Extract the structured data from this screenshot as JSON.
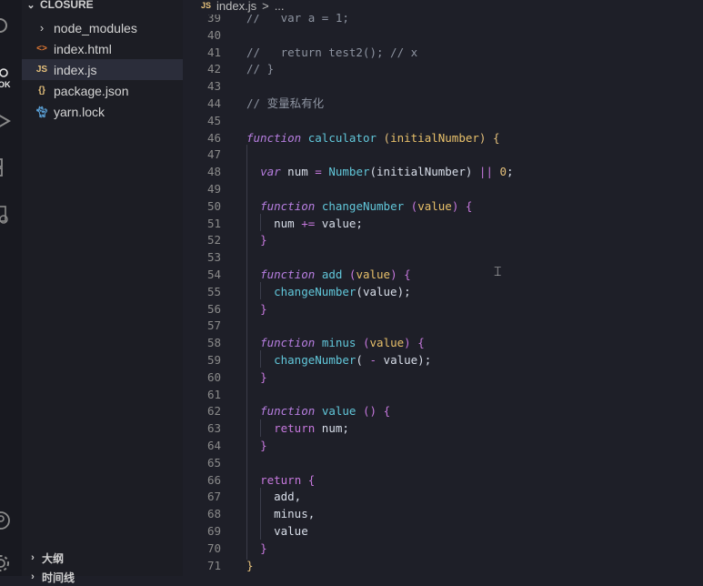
{
  "explorer": {
    "folder_name": "CLOSURE",
    "items": [
      {
        "label": "node_modules",
        "icon": "chevron-right-icon"
      },
      {
        "label": "index.html",
        "icon": "html-icon"
      },
      {
        "label": "index.js",
        "icon": "js-icon",
        "selected": true
      },
      {
        "label": "package.json",
        "icon": "json-icon"
      },
      {
        "label": "yarn.lock",
        "icon": "yarn-icon"
      }
    ],
    "outline_label": "大纲",
    "timeline_label": "时间线"
  },
  "activity_bar": {
    "account_label": "OK"
  },
  "breadcrumb": {
    "file_badge": "JS",
    "file": "index.js",
    "separator": ">",
    "more": "..."
  },
  "editor": {
    "lines": [
      {
        "n": "39",
        "html": "<span class=\"c\">//   var a = 1;</span>"
      },
      {
        "n": "40",
        "html": ""
      },
      {
        "n": "41",
        "html": "<span class=\"c\">//   return test2(); // x</span>"
      },
      {
        "n": "42",
        "html": "<span class=\"c\">// }</span>"
      },
      {
        "n": "43",
        "html": ""
      },
      {
        "n": "44",
        "html": "<span class=\"c\">// 变量私有化</span>"
      },
      {
        "n": "45",
        "html": ""
      },
      {
        "n": "46",
        "html": "<span class=\"k\">function</span> <span class=\"f\">calculator</span> <span class=\"n\">(</span><span class=\"p\">initialNumber</span><span class=\"n\">)</span> <span class=\"n\">{</span>"
      },
      {
        "n": "47",
        "html": ""
      },
      {
        "n": "48",
        "html": "  <span class=\"k\">var</span> num <span class=\"o\">=</span> <span class=\"f\">Number</span>(initialNumber) <span class=\"o\">||</span> <span class=\"n\">0</span>;"
      },
      {
        "n": "49",
        "html": ""
      },
      {
        "n": "50",
        "html": "  <span class=\"k\">function</span> <span class=\"f\">changeNumber</span> <span class=\"o\">(</span><span class=\"p\">value</span><span class=\"o\">)</span> <span class=\"o\">{</span>"
      },
      {
        "n": "51",
        "html": "    num <span class=\"o\">+=</span> value;"
      },
      {
        "n": "52",
        "html": "  <span class=\"o\">}</span>"
      },
      {
        "n": "53",
        "html": ""
      },
      {
        "n": "54",
        "html": "  <span class=\"k\">function</span> <span class=\"f\">add</span> <span class=\"o\">(</span><span class=\"p\">value</span><span class=\"o\">)</span> <span class=\"o\">{</span>"
      },
      {
        "n": "55",
        "html": "    <span class=\"f\">changeNumber</span>(value);"
      },
      {
        "n": "56",
        "html": "  <span class=\"o\">}</span>"
      },
      {
        "n": "57",
        "html": ""
      },
      {
        "n": "58",
        "html": "  <span class=\"k\">function</span> <span class=\"f\">minus</span> <span class=\"o\">(</span><span class=\"p\">value</span><span class=\"o\">)</span> <span class=\"o\">{</span>"
      },
      {
        "n": "59",
        "html": "    <span class=\"f\">changeNumber</span>( <span class=\"o\">-</span> value);"
      },
      {
        "n": "60",
        "html": "  <span class=\"o\">}</span>"
      },
      {
        "n": "61",
        "html": ""
      },
      {
        "n": "62",
        "html": "  <span class=\"k\">function</span> <span class=\"f\">value</span> <span class=\"o\">()</span> <span class=\"o\">{</span>"
      },
      {
        "n": "63",
        "html": "    <span class=\"o\">return</span> num;"
      },
      {
        "n": "64",
        "html": "  <span class=\"o\">}</span>"
      },
      {
        "n": "65",
        "html": ""
      },
      {
        "n": "66",
        "html": "  <span class=\"o\">return</span> <span class=\"o\">{</span>"
      },
      {
        "n": "67",
        "html": "    add,"
      },
      {
        "n": "68",
        "html": "    minus,"
      },
      {
        "n": "69",
        "html": "    value"
      },
      {
        "n": "70",
        "html": "  <span class=\"o\">}</span>"
      },
      {
        "n": "71",
        "html": "<span class=\"n\">}</span>"
      }
    ]
  },
  "colors": {
    "keyword": "#b77ee0",
    "function": "#61c6d9",
    "param": "#e8c06a",
    "comment": "#8d93a0",
    "selection": "#2b2d3a"
  }
}
